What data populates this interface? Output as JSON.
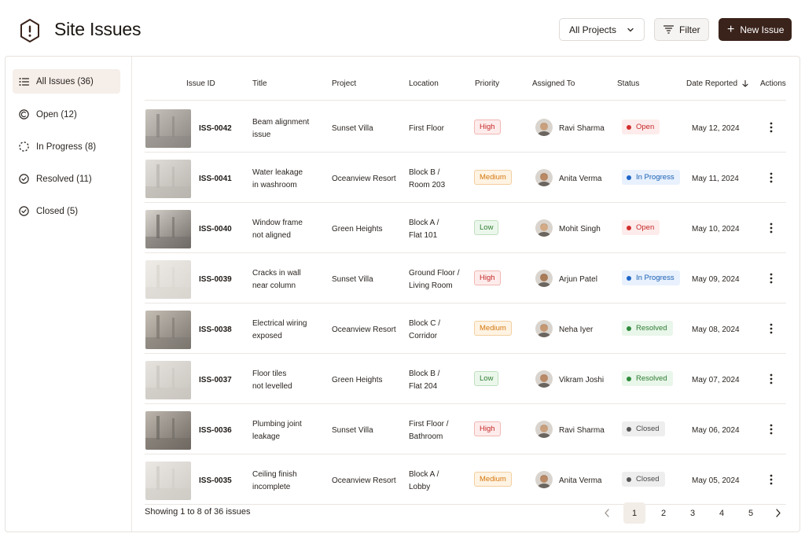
{
  "header": {
    "title": "Site Issues",
    "project_select": "All Projects",
    "filter_label": "Filter",
    "new_issue_label": "New Issue"
  },
  "sidebar": {
    "items": [
      {
        "label": "All Issues (36)",
        "icon": "list-icon",
        "active": true
      },
      {
        "label": "Open (12)",
        "icon": "open-circle-icon",
        "active": false
      },
      {
        "label": "In Progress (8)",
        "icon": "dashed-circle-icon",
        "active": false
      },
      {
        "label": "Resolved (11)",
        "icon": "check-circle-icon",
        "active": false
      },
      {
        "label": "Closed (5)",
        "icon": "check-circle-icon",
        "active": false
      }
    ]
  },
  "table": {
    "columns": {
      "issue_id": "Issue ID",
      "title": "Title",
      "project": "Project",
      "location": "Location",
      "priority": "Priority",
      "assigned_to": "Assigned To",
      "status": "Status",
      "date_reported": "Date Reported",
      "actions": "Actions"
    },
    "rows": [
      {
        "id": "ISS-0042",
        "title1": "Beam alignment",
        "title2": "issue",
        "project": "Sunset Villa",
        "loc1": "First Floor",
        "loc2": "",
        "priority": "High",
        "assignee": "Ravi Sharma",
        "status": "Open",
        "date": "May 12, 2024"
      },
      {
        "id": "ISS-0041",
        "title1": "Water leakage",
        "title2": "in washroom",
        "project": "Oceanview Resort",
        "loc1": "Block B /",
        "loc2": "Room 203",
        "priority": "Medium",
        "assignee": "Anita Verma",
        "status": "In Progress",
        "date": "May 11, 2024"
      },
      {
        "id": "ISS-0040",
        "title1": "Window frame",
        "title2": "not aligned",
        "project": "Green Heights",
        "loc1": "Block A /",
        "loc2": "Flat 101",
        "priority": "Low",
        "assignee": "Mohit Singh",
        "status": "Open",
        "date": "May 10, 2024"
      },
      {
        "id": "ISS-0039",
        "title1": "Cracks in wall",
        "title2": "near column",
        "project": "Sunset Villa",
        "loc1": "Ground Floor /",
        "loc2": "Living Room",
        "priority": "High",
        "assignee": "Arjun Patel",
        "status": "In Progress",
        "date": "May 09, 2024"
      },
      {
        "id": "ISS-0038",
        "title1": "Electrical wiring",
        "title2": "exposed",
        "project": "Oceanview Resort",
        "loc1": "Block C /",
        "loc2": "Corridor",
        "priority": "Medium",
        "assignee": "Neha Iyer",
        "status": "Resolved",
        "date": "May 08, 2024"
      },
      {
        "id": "ISS-0037",
        "title1": "Floor tiles",
        "title2": "not levelled",
        "project": "Green Heights",
        "loc1": "Block B /",
        "loc2": "Flat 204",
        "priority": "Low",
        "assignee": "Vikram Joshi",
        "status": "Resolved",
        "date": "May 07, 2024"
      },
      {
        "id": "ISS-0036",
        "title1": "Plumbing joint",
        "title2": "leakage",
        "project": "Sunset Villa",
        "loc1": "First Floor /",
        "loc2": "Bathroom",
        "priority": "High",
        "assignee": "Ravi Sharma",
        "status": "Closed",
        "date": "May 06, 2024"
      },
      {
        "id": "ISS-0035",
        "title1": "Ceiling finish",
        "title2": "incomplete",
        "project": "Oceanview Resort",
        "loc1": "Block A /",
        "loc2": "Lobby",
        "priority": "Medium",
        "assignee": "Anita Verma",
        "status": "Closed",
        "date": "May 05, 2024"
      }
    ]
  },
  "footer": {
    "showing": "Showing 1 to 8 of 36 issues",
    "pages": [
      "1",
      "2",
      "3",
      "4",
      "5"
    ],
    "current_page": "1"
  },
  "colors": {
    "brand": "#3a231b",
    "high": "#c62828",
    "medium": "#d4780f",
    "low": "#2e7d32",
    "in_progress": "#1a5fb4"
  }
}
